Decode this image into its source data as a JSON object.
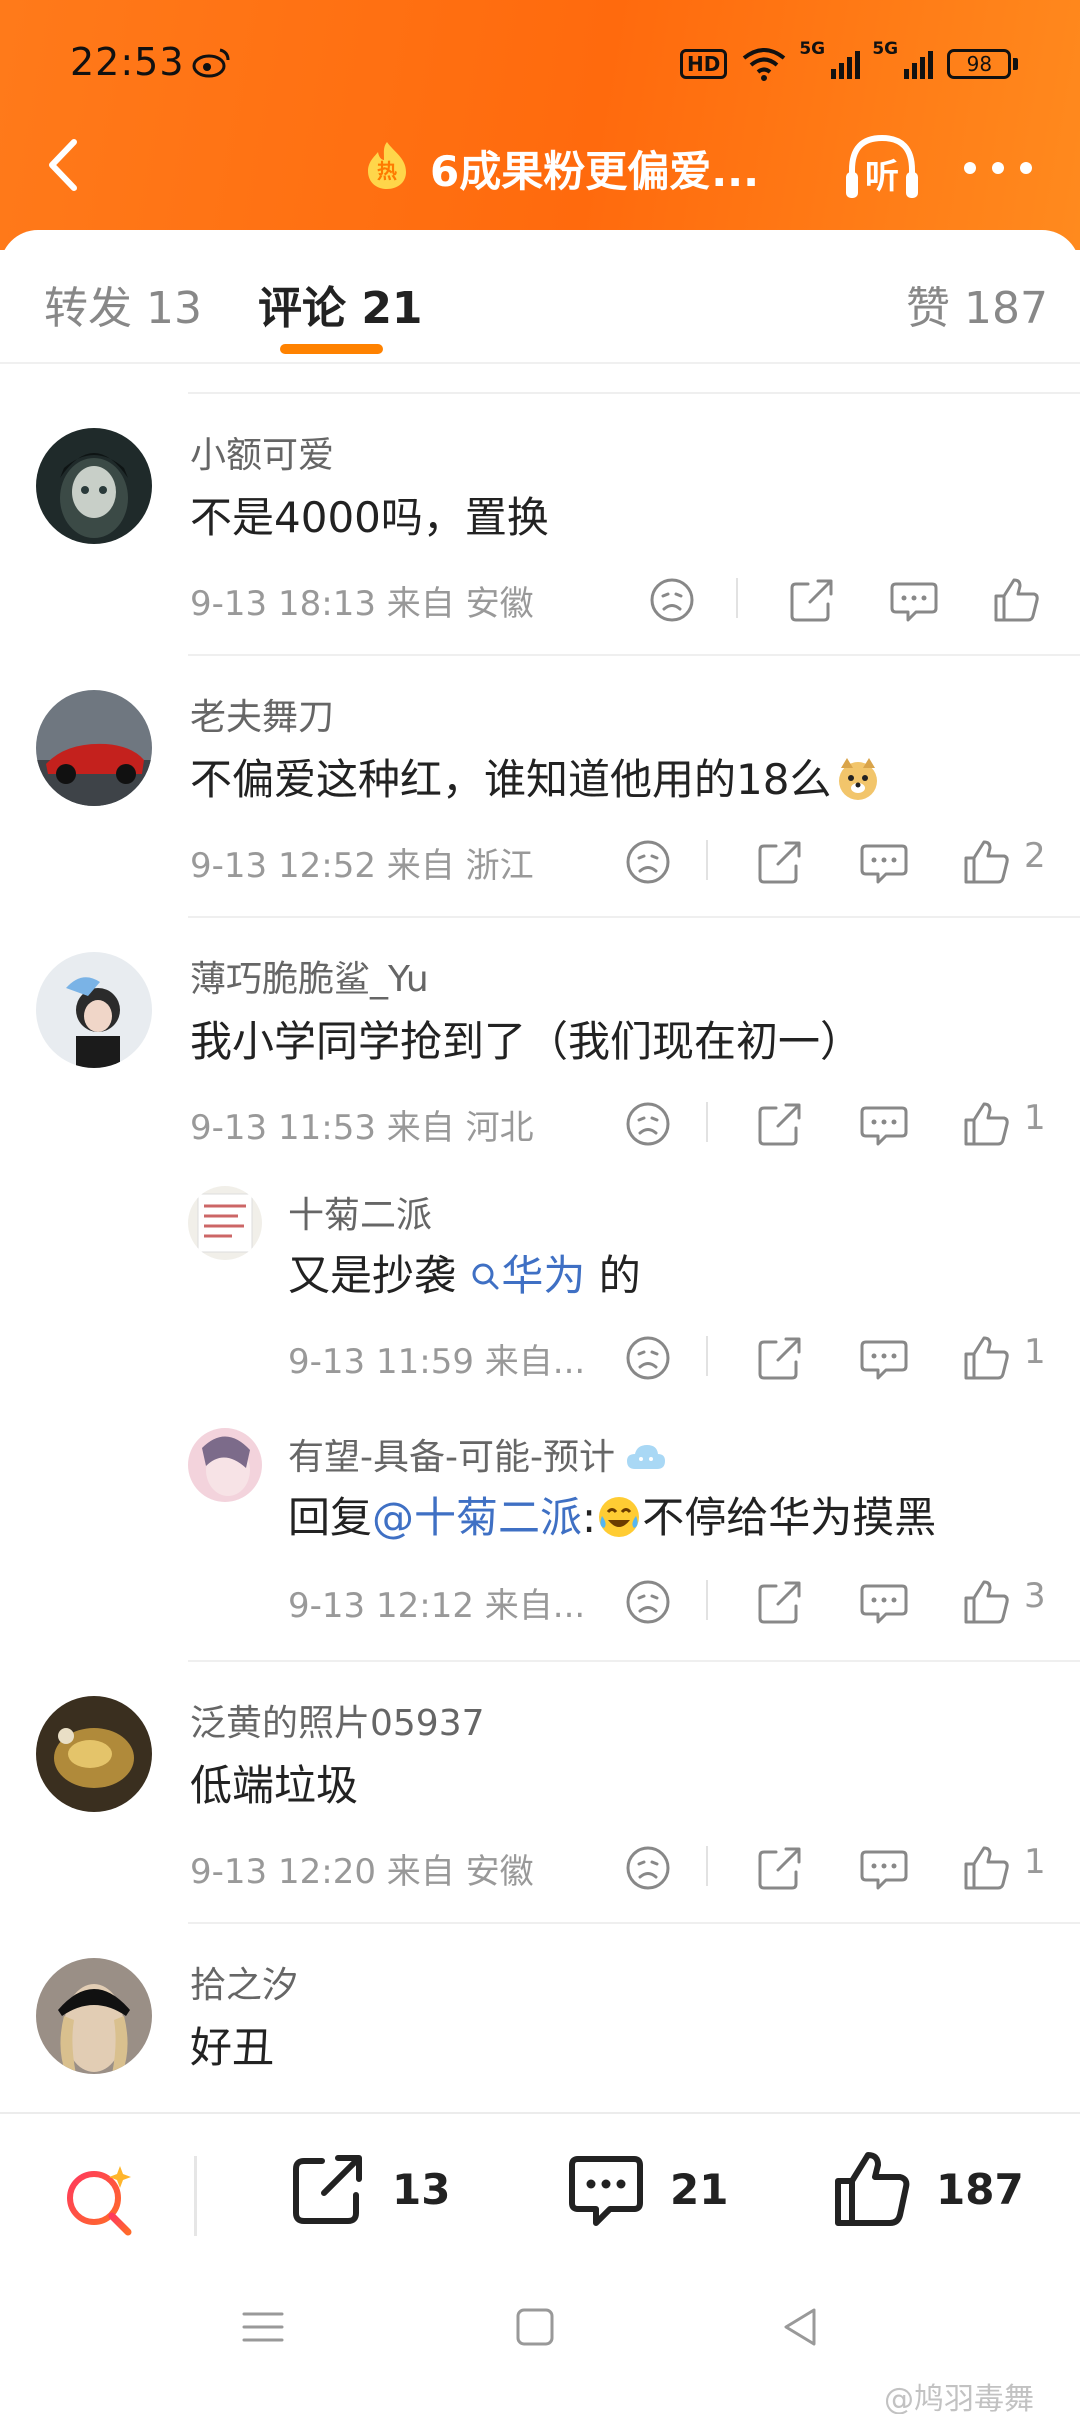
{
  "status_bar": {
    "time": "22:53",
    "hd_label": "HD",
    "network_5g_1": "5G",
    "network_5g_2": "5G",
    "battery": "98"
  },
  "nav": {
    "back_icon": "back-arrow-icon",
    "hot_badge": "热",
    "title": "6成果粉更偏爱...",
    "listen_label": "听"
  },
  "tabs": {
    "repost": "转发 13",
    "comments": "评论 21",
    "likes": "赞 187"
  },
  "comments": [
    {
      "user": "小额可爱",
      "text": "不是4000吗，置换",
      "meta": "9-13 18:13  来自 安徽",
      "likes": ""
    },
    {
      "user": "老夫舞刀",
      "text": "不偏爱这种红，谁知道他用的18么",
      "meta": "9-13 12:52  来自 浙江",
      "likes": "2"
    },
    {
      "user": "薄巧脆脆鲨_Yu",
      "text": "我小学同学抢到了（我们现在初一）",
      "meta": "9-13 11:53  来自 河北",
      "likes": "1"
    },
    {
      "user": "泛黄的照片05937",
      "text": "低端垃圾",
      "meta": "9-13 12:20  来自 安徽",
      "likes": "1"
    },
    {
      "user": "拾之汐",
      "text": "好丑"
    }
  ],
  "replies": [
    {
      "user": "十菊二派",
      "text_before": "又是抄袭 ",
      "link": "华为",
      "text_after": " 的",
      "meta": "9-13 11:59  来自...",
      "likes": "1"
    },
    {
      "user": "有望-具备-可能-预计",
      "reply_prefix": "回复",
      "mention": "@十菊二派",
      "text_after": ":",
      "text_rest": "不停给华为摸黑",
      "meta": "9-13 12:12  来自...",
      "likes": "3"
    }
  ],
  "bottom_bar": {
    "repost_count": "13",
    "comment_count": "21",
    "like_count": "187"
  },
  "watermark": "@鸠羽毒舞",
  "colors": {
    "accent": "#ff8200",
    "header": "#ff7a1a",
    "link": "#3f70c4"
  }
}
